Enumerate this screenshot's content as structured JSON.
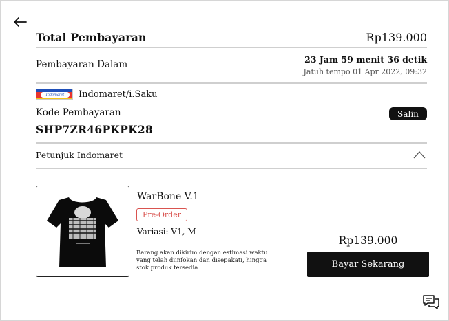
{
  "header": {
    "back_icon": "arrow-left-icon"
  },
  "payment": {
    "total_label": "Total Pembayaran",
    "total_amount": "Rp139.000",
    "due_label": "Pembayaran Dalam",
    "countdown": "23 Jam 59 menit 36 detik",
    "deadline": "Jatuh tempo 01 Apr 2022, 09:32",
    "merchant_name": "Indomaret/i.Saku",
    "merchant_logo_text": "Indomaret",
    "code_label": "Kode Pembayaran",
    "copy_label": "Salin",
    "code_value": "SHP7ZR46PKPK28",
    "instructions_label": "Petunjuk Indomaret",
    "instructions_icon": "chevron-up-icon"
  },
  "product": {
    "name": "WarBone V.1",
    "badge": "Pre-Order",
    "variant": "Variasi: V1, M",
    "shipping_note": "Barang akan dikirim dengan estimasi waktu yang telah diinfokan dan disepakati, hingga stok produk tersedia",
    "price": "Rp139.000",
    "pay_label": "Bayar Sekarang"
  },
  "floating": {
    "chat_icon": "chat-icon"
  },
  "colors": {
    "primary": "#111111",
    "divider": "#cfcfcf",
    "badge": "#d9534f"
  }
}
